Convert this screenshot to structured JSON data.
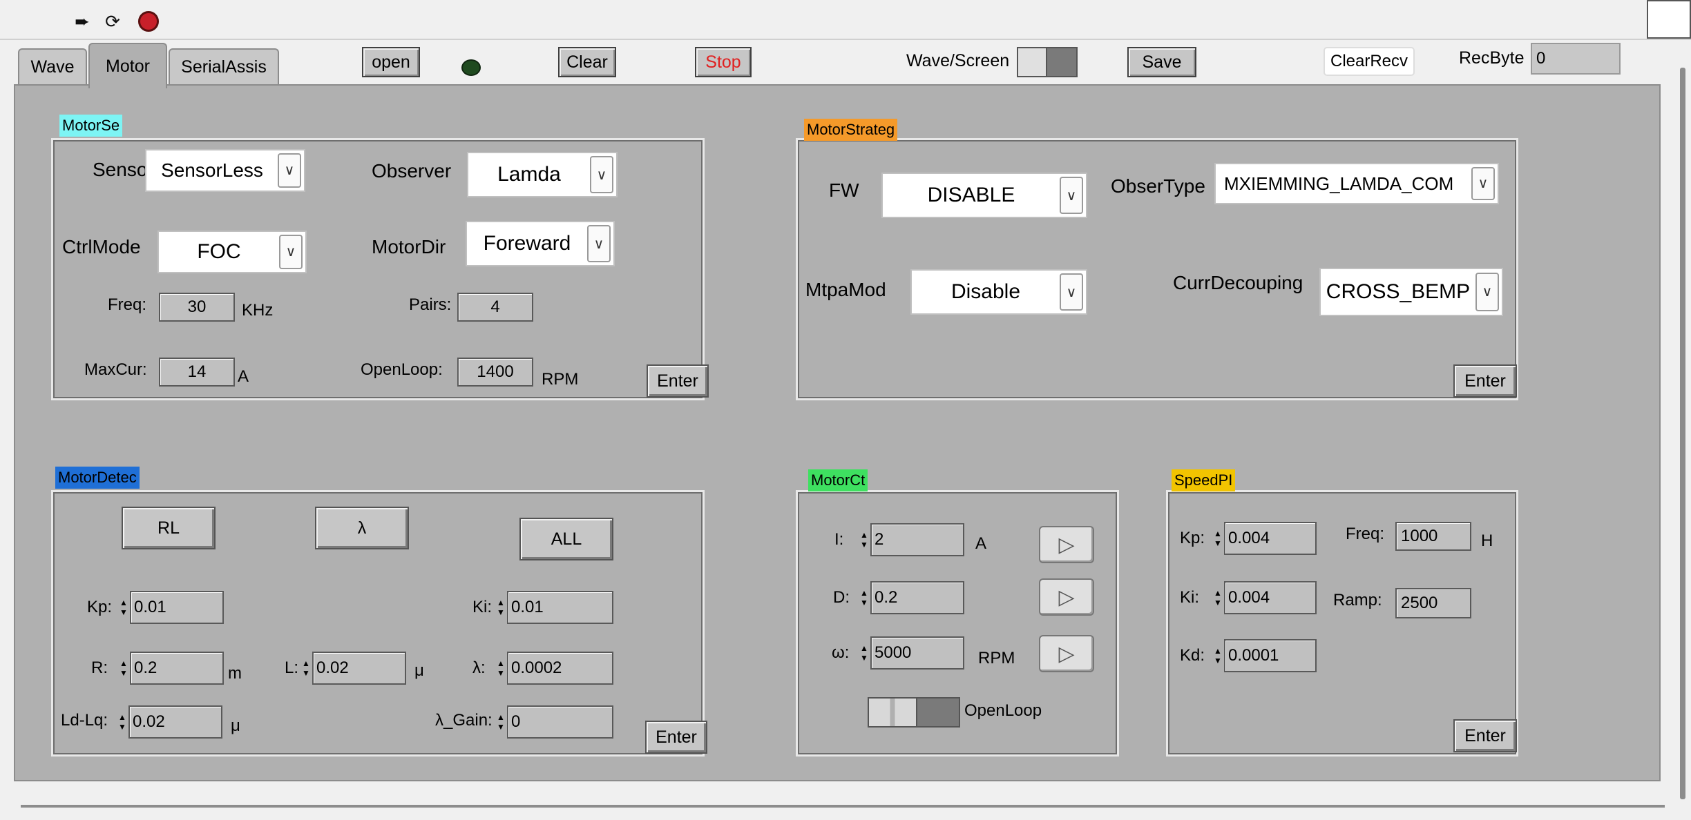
{
  "toolbar": {
    "icons": [
      "run-arrow-icon",
      "run-continuous-icon",
      "abort-stop-icon"
    ],
    "run_glyph": "➨",
    "loop_glyph": "⟳"
  },
  "tabs": [
    {
      "label": "Wave"
    },
    {
      "label": "Motor"
    },
    {
      "label": "SerialAssis"
    }
  ],
  "header": {
    "open_label": "open",
    "clear_label": "Clear",
    "stop_label": "Stop",
    "wave_screen_label": "Wave/Screen",
    "save_label": "Save",
    "clear_recv_label": "ClearRecv",
    "rec_byte_label": "RecByte",
    "rec_byte_value": "0",
    "led_color": "#1f4a1f",
    "stop_color": "#e02020"
  },
  "motor_settings": {
    "title": "MotorSe",
    "title_color": "#7df4f4",
    "sensor_label": "Senso",
    "sensor_value": "SensorLess",
    "observer_label": "Observer",
    "observer_value": "Lamda",
    "ctrl_mode_label": "CtrlMode",
    "ctrl_mode_value": "FOC",
    "motor_dir_label": "MotorDir",
    "motor_dir_value": "Foreward",
    "freq_label": "Freq:",
    "freq_value": "30",
    "freq_unit": "KHz",
    "pairs_label": "Pairs:",
    "pairs_value": "4",
    "maxcur_label": "MaxCur:",
    "maxcur_value": "14",
    "maxcur_unit": "A",
    "openloop_label": "OpenLoop:",
    "openloop_value": "1400",
    "openloop_unit": "RPM",
    "enter_label": "Enter"
  },
  "motor_strategy": {
    "title": "MotorStrateg",
    "title_color": "#f59a2a",
    "fw_label": "FW",
    "fw_value": "DISABLE",
    "obser_type_label": "ObserType",
    "obser_type_value": "MXIEMMING_LAMDA_COM",
    "mtpa_label": "MtpaMod",
    "mtpa_value": "Disable",
    "curr_decoupling_label": "CurrDecouping",
    "curr_decoupling_value": "CROSS_BEMP",
    "enter_label": "Enter"
  },
  "motor_detect": {
    "title": "MotorDetec",
    "title_color": "#1f6fd6",
    "rl_label": "RL",
    "lambda_label": "λ",
    "all_label": "ALL",
    "kp_label": "Kp:",
    "kp_value": "0.01",
    "ki_label": "Ki:",
    "ki_value": "0.01",
    "r_label": "R:",
    "r_value": "0.2",
    "r_unit": "m",
    "l_label": "L:",
    "l_value": "0.02",
    "l_unit": "μ",
    "lambda_field_label": "λ:",
    "lambda_value": "0.0002",
    "ldlq_label": "Ld-Lq:",
    "ldlq_value": "0.02",
    "ldlq_unit": "μ",
    "lambda_gain_label": "λ_Gain:",
    "lambda_gain_value": "0",
    "enter_label": "Enter"
  },
  "motor_ctrl": {
    "title": "MotorCt",
    "title_color": "#3ee060",
    "i_label": "I:",
    "i_value": "2",
    "i_unit": "A",
    "d_label": "D:",
    "d_value": "0.2",
    "w_label": "ω:",
    "w_value": "5000",
    "w_unit": "RPM",
    "openloop_toggle_label": "OpenLoop",
    "run_glyph": "▷"
  },
  "speed_pi": {
    "title": "SpeedPI",
    "title_color": "#f2c400",
    "kp_label": "Kp:",
    "kp_value": "0.004",
    "ki_label": "Ki:",
    "ki_value": "0.004",
    "kd_label": "Kd:",
    "kd_value": "0.0001",
    "freq_label": "Freq:",
    "freq_value": "1000",
    "freq_unit": "H",
    "ramp_label": "Ramp:",
    "ramp_value": "2500",
    "enter_label": "Enter"
  }
}
